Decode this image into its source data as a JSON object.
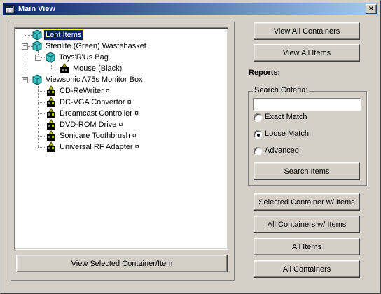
{
  "window": {
    "title": "Main View",
    "close_label": "×"
  },
  "tree": {
    "items": [
      {
        "label": "Lent Items",
        "icon": "container-icon",
        "selected": true
      },
      {
        "label": "Sterilite (Green) Wastebasket",
        "icon": "container-icon",
        "expander": "−"
      },
      {
        "label": "Toys'R'Us Bag",
        "icon": "container-icon",
        "expander": "−"
      },
      {
        "label": "Mouse (Black)",
        "icon": "item-icon"
      },
      {
        "label": "Viewsonic A75s Monitor Box",
        "icon": "container-icon",
        "expander": "−"
      },
      {
        "label": "CD-ReWriter ¤",
        "icon": "lent-item-icon"
      },
      {
        "label": "DC-VGA Convertor ¤",
        "icon": "lent-item-icon"
      },
      {
        "label": "Dreamcast Controller ¤",
        "icon": "lent-item-icon"
      },
      {
        "label": "DVD-ROM Drive ¤",
        "icon": "lent-item-icon"
      },
      {
        "label": "Sonicare Toothbrush ¤",
        "icon": "lent-item-icon"
      },
      {
        "label": "Universal RF Adapter ¤",
        "icon": "lent-item-icon"
      }
    ]
  },
  "buttons": {
    "view_selected": "View Selected Container/Item",
    "view_all_containers": "View All Containers",
    "view_all_items": "View All Items",
    "search_items": "Search Items",
    "selected_container_w_items": "Selected Container w/ Items",
    "all_containers_w_items": "All Containers w/ Items",
    "all_items": "All Items",
    "all_containers": "All Containers"
  },
  "reports": {
    "label": "Reports:",
    "search_criteria_label": "Search Criteria:",
    "search_value": "",
    "options": [
      {
        "label": "Exact Match",
        "checked": false
      },
      {
        "label": "Loose Match",
        "checked": true
      },
      {
        "label": "Advanced",
        "checked": false
      }
    ]
  },
  "colors": {
    "face": "#d4d0c8",
    "title_start": "#0a246a",
    "title_end": "#a6caf0",
    "selection": "#0a246a",
    "container_icon": "#40c0c0"
  }
}
